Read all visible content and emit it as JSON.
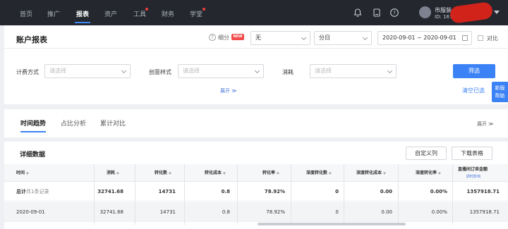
{
  "topnav": {
    "items": [
      "首页",
      "推广",
      "报表",
      "资产",
      "工具",
      "财务",
      "学堂"
    ],
    "active": "报表",
    "account_name": "市服装",
    "account_id": "ID: 167"
  },
  "filters": {
    "page_title": "账户报表",
    "xifen_label": "细分",
    "new_badge": "NEW",
    "segment_value": "无",
    "granularity_value": "分日",
    "date_range": "2020-09-01 ~ 2020-09-01",
    "compare_label": "对比",
    "billing_label": "计费方式",
    "billing_placeholder": "请选择",
    "creative_label": "创意样式",
    "creative_placeholder": "请选择",
    "spend_label": "消耗",
    "spend_placeholder": "请选择",
    "expand_label": "展开 ≫",
    "filter_button": "筛选",
    "clear_link": "清空已选",
    "float_tab": [
      "新版",
      "帮助"
    ]
  },
  "trend": {
    "tabs": [
      "时间趋势",
      "占比分析",
      "累计对比"
    ],
    "expand_label": "展开 ≫",
    "section_title": "详细数据",
    "custom_columns_button": "自定义列",
    "download_button": "下载表格"
  },
  "table": {
    "columns": [
      "时间",
      "消耗",
      "转化数",
      "转化成本",
      "转化率",
      "深度转化数",
      "深度转化成本",
      "深度转化率",
      "直播间订单金额"
    ],
    "column_subtitle": "即时影响",
    "rows": [
      {
        "time": "总计",
        "time_suffix": "共1条记录",
        "spend": "32741.68",
        "conv": "14731",
        "cost": "0.8",
        "rate": "78.92%",
        "deep_conv": "0",
        "deep_cost": "0.00",
        "deep_rate": "0.00%",
        "live_amount": "1357918.71"
      },
      {
        "time": "2020-09-01",
        "time_suffix": "",
        "spend": "32741.68",
        "conv": "14731",
        "cost": "0.8",
        "rate": "78.92%",
        "deep_conv": "0",
        "deep_cost": "0.00",
        "deep_rate": "0.00%",
        "live_amount": "1357918.71"
      }
    ]
  },
  "colors": {
    "primary": "#3b82f6",
    "topnav_bg": "#24272e",
    "badge_red": "#f04a4a"
  }
}
